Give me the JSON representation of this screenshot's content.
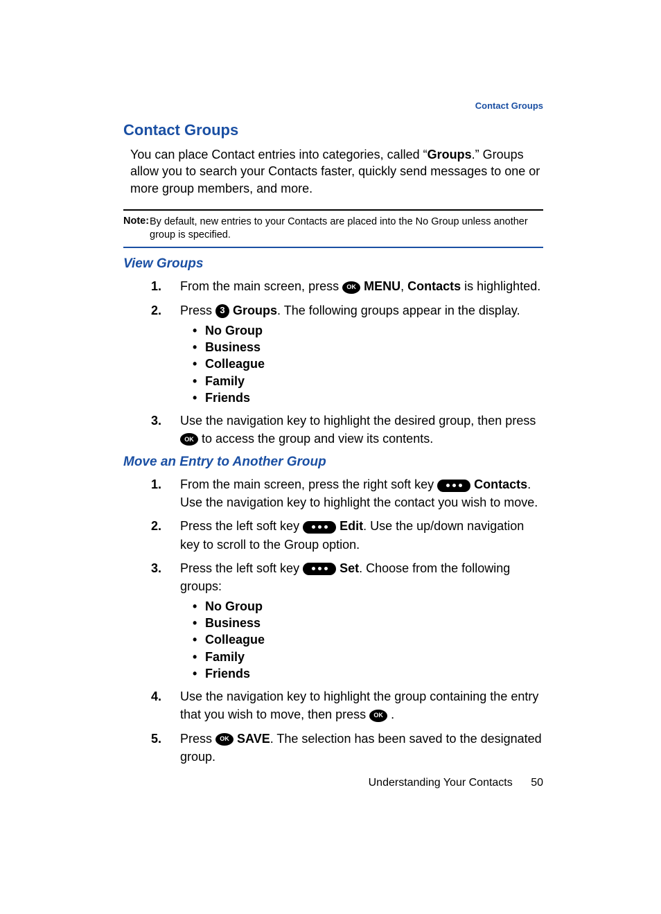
{
  "header": {
    "breadcrumb": "Contact Groups"
  },
  "section1": {
    "title": "Contact Groups",
    "intro_pre": "You can place Contact entries into categories, called “",
    "intro_bold": "Groups",
    "intro_post": ".” Groups allow you to search your Contacts faster, quickly send messages to one or more group members, and more."
  },
  "note": {
    "label": "Note:",
    "text": "By default, new entries to your Contacts are placed into the No Group unless another group is specified."
  },
  "view": {
    "title": "View Groups",
    "step1_pre": "From the main screen, press ",
    "step1_menu": "MENU",
    "step1_sep": ", ",
    "step1_contacts": "Contacts",
    "step1_post": " is highlighted.",
    "step2_pre": "Press ",
    "step2_groups": "Groups",
    "step2_post": ". The following groups appear in the display.",
    "groups": [
      "No Group",
      "Business",
      "Colleague",
      "Family",
      "Friends"
    ],
    "step3_pre": "Use the navigation key to highlight the desired group, then press ",
    "step3_post": " to access the group and view its contents."
  },
  "move": {
    "title": "Move an Entry to Another Group",
    "s1_pre": "From the main screen, press the right soft key ",
    "s1_contacts": "Contacts",
    "s1_post": ". Use the navigation key to highlight the contact you wish to move.",
    "s2_pre": "Press the left soft key ",
    "s2_edit": "Edit",
    "s2_post": ". Use the up/down navigation key to scroll to the Group option.",
    "s3_pre": "Press the left soft key ",
    "s3_set": "Set",
    "s3_post": ". Choose from the following groups:",
    "groups": [
      "No Group",
      "Business",
      "Colleague",
      "Family",
      "Friends"
    ],
    "s4_pre": "Use the navigation key to highlight the group containing the entry that you wish to move, then press ",
    "s4_post": ".",
    "s5_pre": "Press ",
    "s5_save": "SAVE",
    "s5_post": ". The selection has been saved to the designated group."
  },
  "footer": {
    "chapter": "Understanding Your Contacts",
    "page": "50"
  },
  "icons": {
    "ok": "OK",
    "num3": "3"
  }
}
